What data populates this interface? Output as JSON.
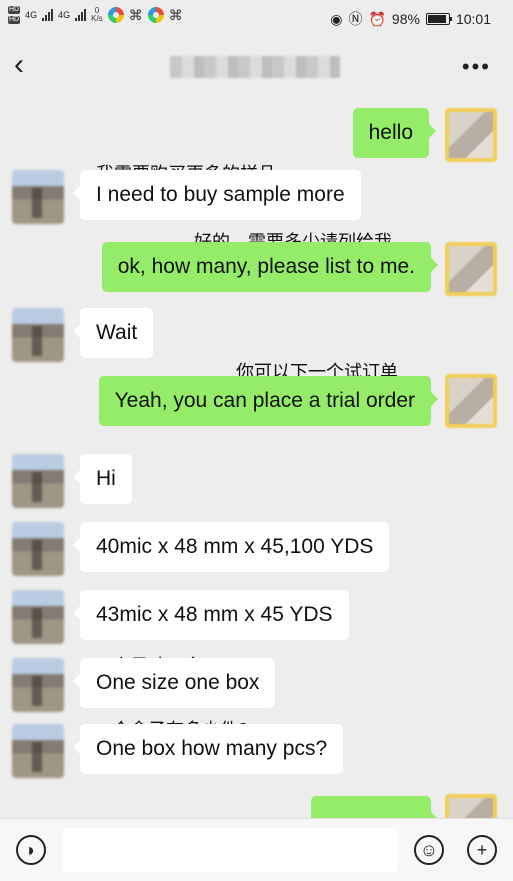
{
  "status_bar": {
    "signal_1": "4G",
    "signal_2": "4G",
    "net_speed_value": "0",
    "net_speed_unit": "K/s",
    "battery": "98%",
    "time": "10:01",
    "left_icons": [
      "hd-icon",
      "signal-icon",
      "signal-icon",
      "app-icon",
      "app-icon"
    ],
    "right_icons": [
      "eye-icon",
      "nfc-icon",
      "alarm-icon",
      "battery-icon"
    ]
  },
  "header": {
    "back_icon": "back-arrow-icon",
    "title": "",
    "more_icon": "more-dots-icon"
  },
  "messages": [
    {
      "side": "out",
      "text": "hello",
      "annotation": ""
    },
    {
      "side": "in",
      "text": "I need to buy sample more",
      "annotation": "我需要购买更多的样品"
    },
    {
      "side": "out",
      "text": "ok, how many, please list to me.",
      "annotation": "好的，需要多少请列给我"
    },
    {
      "side": "in",
      "text": "Wait",
      "annotation": ""
    },
    {
      "side": "out",
      "text": "Yeah, you can place a trial order",
      "annotation": "你可以下一个试订单"
    },
    {
      "side": "in",
      "text": "Hi",
      "annotation": ""
    },
    {
      "side": "in",
      "text": "40mic x 48 mm x 45,100 YDS",
      "annotation": ""
    },
    {
      "side": "in",
      "text": "43mic x 48 mm x 45 YDS",
      "annotation": ""
    },
    {
      "side": "in",
      "text": "One size one box",
      "annotation": "一个尺寸一盒"
    },
    {
      "side": "in",
      "text": "One box how many pcs?",
      "annotation": "一个盒子有多少件?"
    },
    {
      "side": "out",
      "text": "",
      "annotation": ""
    }
  ],
  "input_bar": {
    "voice_icon": "voice-icon",
    "text_value": "",
    "emoji_icon": "emoji-icon",
    "plus_icon": "plus-icon"
  }
}
